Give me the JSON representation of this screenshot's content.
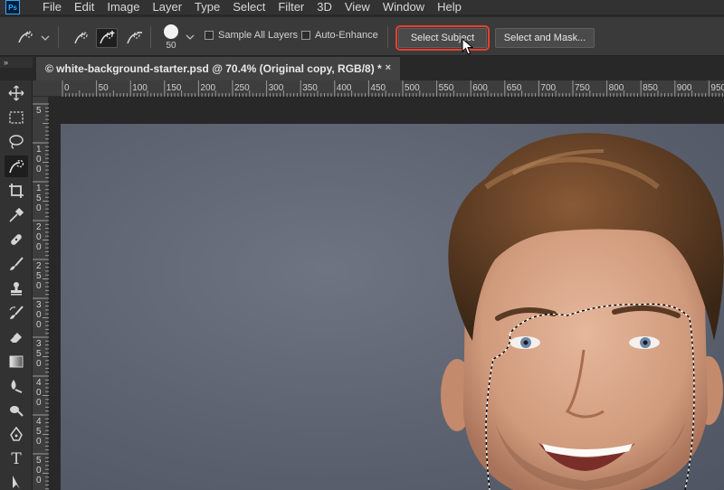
{
  "app": {
    "logo": "Ps"
  },
  "menu": [
    "File",
    "Edit",
    "Image",
    "Layer",
    "Type",
    "Select",
    "Filter",
    "3D",
    "View",
    "Window",
    "Help"
  ],
  "options": {
    "brush_size": "50",
    "sample_all_layers": {
      "label": "Sample All Layers",
      "checked": false
    },
    "auto_enhance": {
      "label": "Auto-Enhance",
      "checked": false
    },
    "select_subject": "Select Subject",
    "select_and_mask": "Select and Mask...",
    "highlight_color": "#e3402f"
  },
  "panel_collapse": "»",
  "document_tab": {
    "title": "© white-background-starter.psd @ 70.4% (Original copy, RGB/8) *",
    "close": "×"
  },
  "ruler_h": [
    "0",
    "50",
    "100",
    "150",
    "200",
    "250",
    "300",
    "350",
    "400",
    "450",
    "500",
    "550",
    "600",
    "650",
    "700",
    "750",
    "800",
    "850",
    "900",
    "950"
  ],
  "ruler_v": [
    "5",
    "1 0 0",
    "1 5 0",
    "2 0 0",
    "2 5 0",
    "3 0 0",
    "3 5 0",
    "4 0 0",
    "4 5 0",
    "5 0 0"
  ],
  "tools": [
    "move-icon",
    "marquee-icon",
    "lasso-icon",
    "quick-selection-icon",
    "crop-icon",
    "eyedropper-icon",
    "healing-brush-icon",
    "brush-icon",
    "clone-stamp-icon",
    "history-brush-icon",
    "eraser-icon",
    "gradient-icon",
    "blur-icon",
    "dodge-icon",
    "pen-icon",
    "type-icon",
    "path-selection-icon"
  ],
  "type_tool_glyph": "T",
  "colors": {
    "accent_red": "#e3402f",
    "background_gray": "#5c626f"
  }
}
